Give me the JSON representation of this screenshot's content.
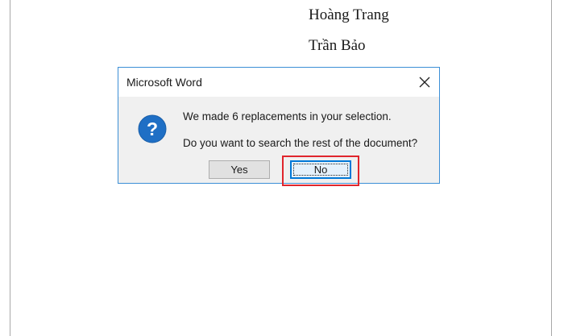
{
  "document": {
    "lines": [
      "Hoàng Trang",
      "Trần Bảo"
    ]
  },
  "dialog": {
    "title": "Microsoft Word",
    "close_icon": "close-icon",
    "icon": "question-icon",
    "message_line_1": "We made 6 replacements in your selection.",
    "message_line_2": "Do you want to search the rest of the document?",
    "buttons": {
      "yes_label": "Yes",
      "no_label": "No"
    },
    "default_button": "No"
  },
  "annotation": {
    "highlight_color": "#e0252c",
    "highlighted": "No"
  },
  "colors": {
    "dialog_border": "#3c8fd6",
    "icon_blue": "#1f6fc5",
    "focus_blue": "#0078d7"
  }
}
